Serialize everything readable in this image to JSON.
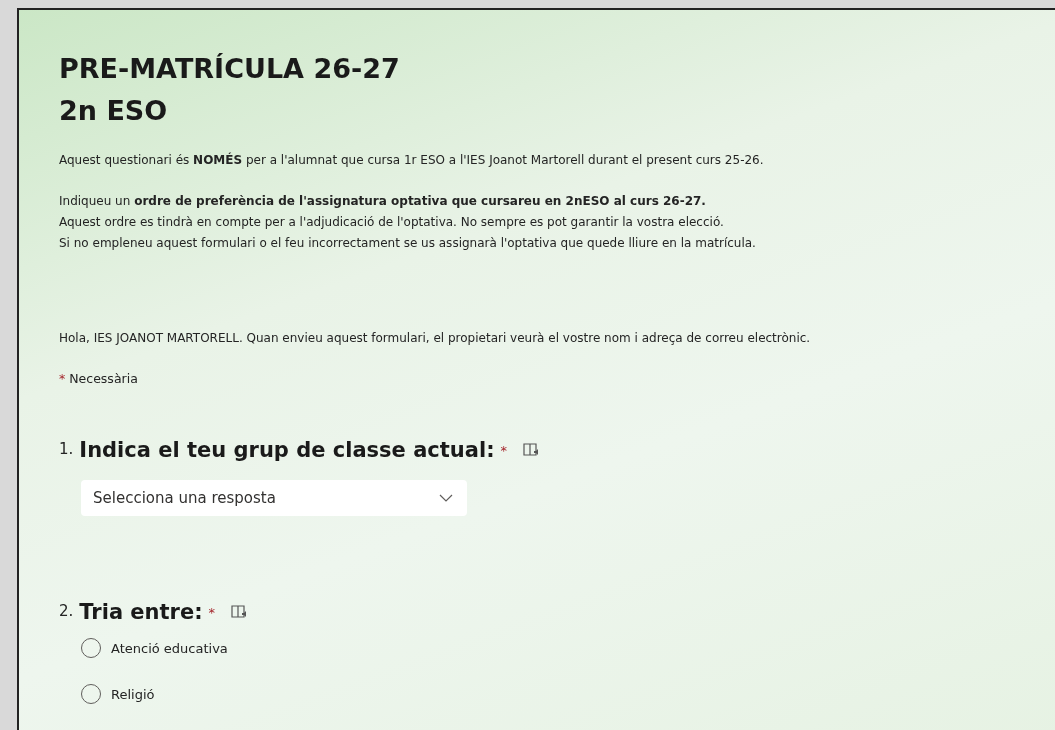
{
  "form": {
    "title": "PRE-MATRÍCULA 26-27",
    "subtitle": "2n ESO",
    "description": [
      "Aquest questionari és **NOMÉS** per a l'alumnat que cursa 1r ESO a l'IES Joanot Martorell durant el present curs 25-26.",
      "Indiqueu un **ordre de preferència de l'assignatura optativa que cursareu en 2nESO al curs 26-27.**\nAquest ordre es tindrà en compte per a l'adjudicació de l'optativa. No sempre es pot garantir la vostra elecció.\nSi no empleneu aquest formulari o el feu incorrectament se us assignarà l'optativa que quede lliure en la matrícula."
    ],
    "notice": "Hola, IES JOANOT MARTORELL. Quan envieu aquest formulari, el propietari veurà el vostre nom i adreça de correu electrònic.",
    "required_legend": {
      "mark": "*",
      "label": "Necessària"
    },
    "questions": [
      {
        "number": "1.",
        "title": "Indica el teu grup de classe actual:",
        "required": true,
        "required_mark": "*",
        "kind": "dropdown",
        "placeholder": "Selecciona una resposta"
      },
      {
        "number": "2.",
        "title": "Tria entre:",
        "required": true,
        "required_mark": "*",
        "kind": "choice",
        "options": [
          {
            "label": "Atenció educativa",
            "selected": false
          },
          {
            "label": "Religió",
            "selected": false
          }
        ]
      }
    ]
  }
}
